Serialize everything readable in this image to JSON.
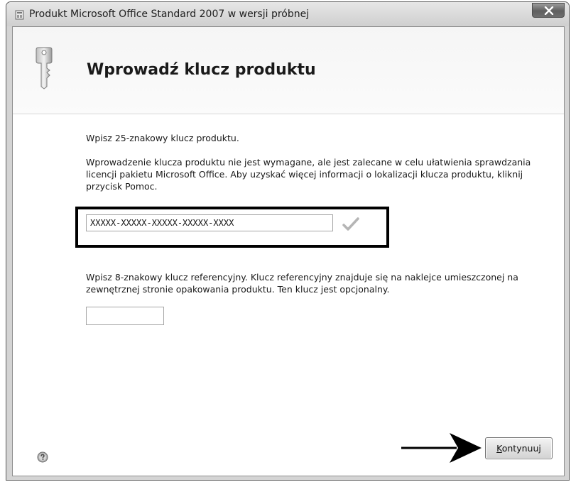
{
  "window": {
    "title": "Produkt Microsoft Office Standard 2007 w wersji próbnej",
    "close_icon": "close-x-icon"
  },
  "header": {
    "icon": "key-icon",
    "title": "Wprowadź klucz produktu"
  },
  "main": {
    "intro": "Wpisz 25-znakowy klucz produktu.",
    "description": "Wprowadzenie klucza produktu nie jest wymagane, ale jest zalecane w celu ułatwienia sprawdzania licencji pakietu Microsoft Office. Aby uzyskać więcej informacji o lokalizacji klucza produktu, kliknij przycisk Pomoc.",
    "product_key": {
      "value": "XXXXX-XXXXX-XXXXX-XXXXX-XXXX",
      "validation_icon": "checkmark-icon"
    },
    "reference_description": "Wpisz 8-znakowy klucz referencyjny. Klucz referencyjny znajduje się na naklejce umieszczonej na zewnętrznej stronie opakowania produktu. Ten klucz jest opcjonalny.",
    "reference_key": {
      "value": ""
    }
  },
  "footer": {
    "help_icon": "help-icon",
    "continue_mnemonic": "K",
    "continue_rest": "ontynuuj"
  }
}
